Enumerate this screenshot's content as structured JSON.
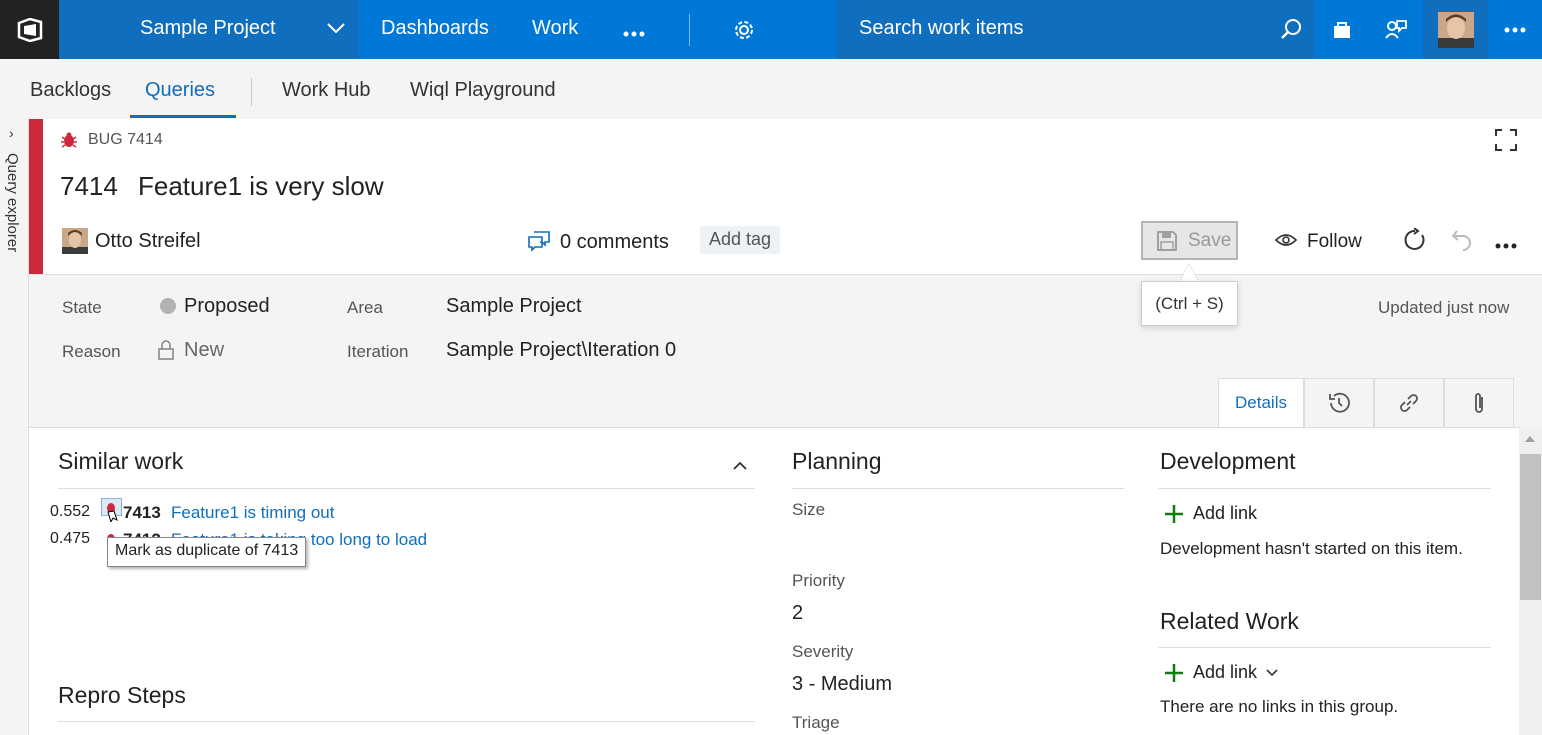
{
  "topbar": {
    "project_name": "Sample Project",
    "nav": [
      "Dashboards",
      "Work"
    ],
    "search_placeholder": "Search work items",
    "colors": {
      "bar": "#0078d7",
      "dark": "#106ebe",
      "logo_bg": "#222222"
    }
  },
  "subnav": {
    "items": [
      "Backlogs",
      "Queries",
      "Work Hub",
      "Wiql Playground"
    ],
    "active": "Queries"
  },
  "rail": {
    "label": "Query explorer"
  },
  "work_item": {
    "type_label": "BUG 7414",
    "id": "7414",
    "title": "Feature1 is very slow",
    "owner": "Otto Streifel",
    "comments": "0 comments",
    "add_tag": "Add tag",
    "save_label": "Save",
    "save_tooltip": "(Ctrl + S)",
    "follow_label": "Follow",
    "accent_color": "#cc293d"
  },
  "fields": {
    "state_label": "State",
    "state_value": "Proposed",
    "reason_label": "Reason",
    "reason_value": "New",
    "area_label": "Area",
    "area_value": "Sample Project",
    "iteration_label": "Iteration",
    "iteration_value": "Sample Project\\Iteration 0",
    "updated": "Updated just now"
  },
  "tabs": {
    "details": "Details",
    "icons": [
      "history-icon",
      "link-icon",
      "attachment-icon"
    ]
  },
  "similar_work": {
    "title": "Similar work",
    "items": [
      {
        "score": "0.552",
        "id": "7413",
        "title": "Feature1 is timing out"
      },
      {
        "score": "0.475",
        "id": "7412",
        "title": "Feature1 is taking too long to load"
      }
    ],
    "tooltip": "Mark as duplicate of 7413"
  },
  "repro": {
    "title": "Repro Steps"
  },
  "planning": {
    "title": "Planning",
    "size_label": "Size",
    "priority_label": "Priority",
    "priority_value": "2",
    "severity_label": "Severity",
    "severity_value": "3 - Medium",
    "triage_label": "Triage"
  },
  "development": {
    "title": "Development",
    "add_link": "Add link",
    "note": "Development hasn't started on this item."
  },
  "related_work": {
    "title": "Related Work",
    "add_link": "Add link",
    "note": "There are no links in this group."
  }
}
